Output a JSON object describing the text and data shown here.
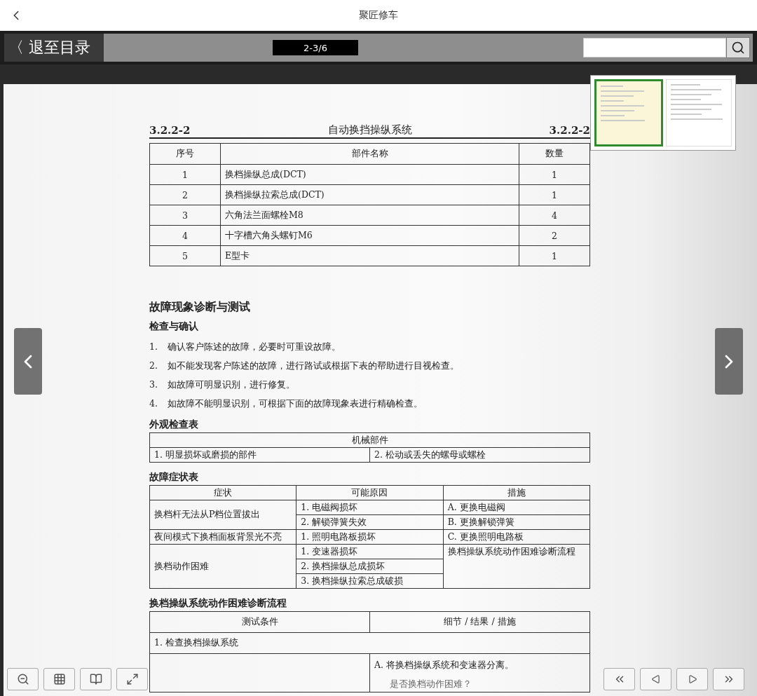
{
  "app_bar": {
    "title": "聚匠修车"
  },
  "toolbar": {
    "back_label": "〈 退至目录",
    "page_indicator": "2-3/6"
  },
  "thumbnail": {
    "pages": [
      {
        "selected": true
      },
      {
        "selected": false
      }
    ]
  },
  "document": {
    "header": {
      "code_left": "3.2.2-2",
      "title": "自动换挡操纵系统",
      "code_right": "3.2.2-2"
    },
    "parts_table": {
      "columns": [
        "序号",
        "部件名称",
        "数量"
      ],
      "rows": [
        [
          "1",
          "换档操纵总成(DCT)",
          "1"
        ],
        [
          "2",
          "换档操纵拉索总成(DCT)",
          "1"
        ],
        [
          "3",
          "六角法兰面螺栓M8",
          "4"
        ],
        [
          "4",
          "十字槽六角头螺钉M6",
          "2"
        ],
        [
          "5",
          "E型卡",
          "1"
        ]
      ]
    },
    "section_title": "故障现象诊断与测试",
    "subsection_title": "检查与确认",
    "steps": [
      {
        "number": "1.",
        "text": "确认客户陈述的故障，必要时可重设故障。"
      },
      {
        "number": "2.",
        "text": "如不能发现客户陈述的故障，进行路试或根据下表的帮助进行目视检查。"
      },
      {
        "number": "3.",
        "text": "如故障可明显识别，进行修复。"
      },
      {
        "number": "4.",
        "text": "如故障不能明显识别，可根据下面的故障现象表进行精确检查。"
      }
    ],
    "visual_check": {
      "title": "外观检查表",
      "header": "机械部件",
      "items": [
        "1. 明显损坏或磨损的部件",
        "2. 松动或丢失的螺母或螺栓"
      ]
    },
    "symptom_table": {
      "title": "故障症状表",
      "columns": [
        "症状",
        "可能原因",
        "措施"
      ],
      "groups": [
        {
          "symptom": "换档杆无法从P档位置拔出",
          "causes": [
            "1. 电磁阀损坏",
            "2. 解锁弹簧失效"
          ],
          "actions": [
            "A. 更换电磁阀",
            "B. 更换解锁弹簧"
          ]
        },
        {
          "symptom": "夜间模式下换档面板背景光不亮",
          "causes": [
            "1. 照明电路板损坏"
          ],
          "actions": [
            "C. 更换照明电路板"
          ]
        },
        {
          "symptom": "换档动作困难",
          "causes": [
            "1. 变速器损坏",
            "2. 换档操纵总成损坏",
            "3. 换档操纵拉索总成破损"
          ],
          "actions": [
            "换档操纵系统动作困难诊断流程"
          ]
        }
      ]
    },
    "flow_table": {
      "title": "换档操纵系统动作困难诊断流程",
      "columns": [
        "测试条件",
        "细节 / 结果 / 措施"
      ],
      "rows": [
        {
          "kind": "step",
          "text": "1. 检查换档操纵系统"
        },
        {
          "kind": "detail",
          "action": "A. 将换档操纵系统和变速器分离。",
          "question": "是否换档动作困难？"
        }
      ]
    }
  }
}
